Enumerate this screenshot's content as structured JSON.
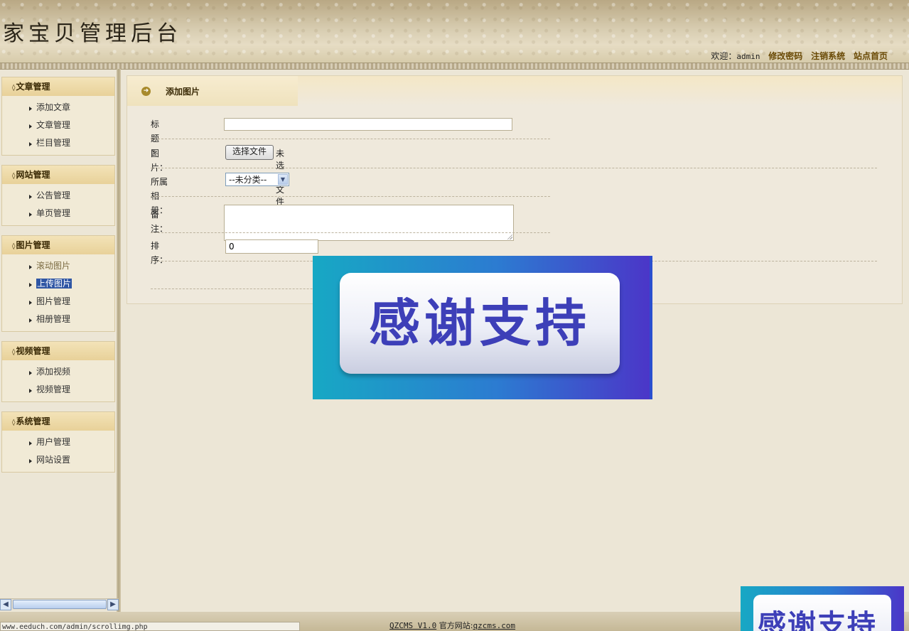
{
  "header": {
    "title": "家宝贝管理后台",
    "welcome_label": "欢迎：",
    "username": "admin",
    "links": [
      "修改密码",
      "注销系统",
      "站点首页"
    ]
  },
  "sidebar": {
    "groups": [
      {
        "title": "文章管理",
        "items": [
          "添加文章",
          "文章管理",
          "栏目管理"
        ]
      },
      {
        "title": "网站管理",
        "items": [
          "公告管理",
          "单页管理"
        ]
      },
      {
        "title": "图片管理",
        "items": [
          "滚动图片",
          "上传图片",
          "图片管理",
          "相册管理"
        ]
      },
      {
        "title": "视频管理",
        "items": [
          "添加视频",
          "视频管理"
        ]
      },
      {
        "title": "系统管理",
        "items": [
          "用户管理",
          "网站设置"
        ]
      }
    ],
    "selected_item": "上传图片",
    "chevron_glyph": "◊"
  },
  "panel": {
    "title": "添加图片",
    "form": {
      "title_label": "标题 ：",
      "title_value": "",
      "image_label": "图片：",
      "file_button": "选择文件",
      "file_status": "未选择文件",
      "album_label": "所属相册：",
      "album_selected": "--未分类--",
      "note_label": "备注：",
      "note_value": "",
      "order_label": "排序：",
      "order_value": "0"
    }
  },
  "overlay": {
    "banner_text": "感谢支持"
  },
  "footer": {
    "status_url": "www.eeduch.com/admin/scrollimg.php",
    "product": "QZCMS  V1.0",
    "site_label": "官方网站:",
    "site_url": "qzcms.com"
  },
  "colors": {
    "accent": "#2f56a4",
    "menu_head": "#e8d199",
    "banner_text": "#3d3fb8"
  }
}
